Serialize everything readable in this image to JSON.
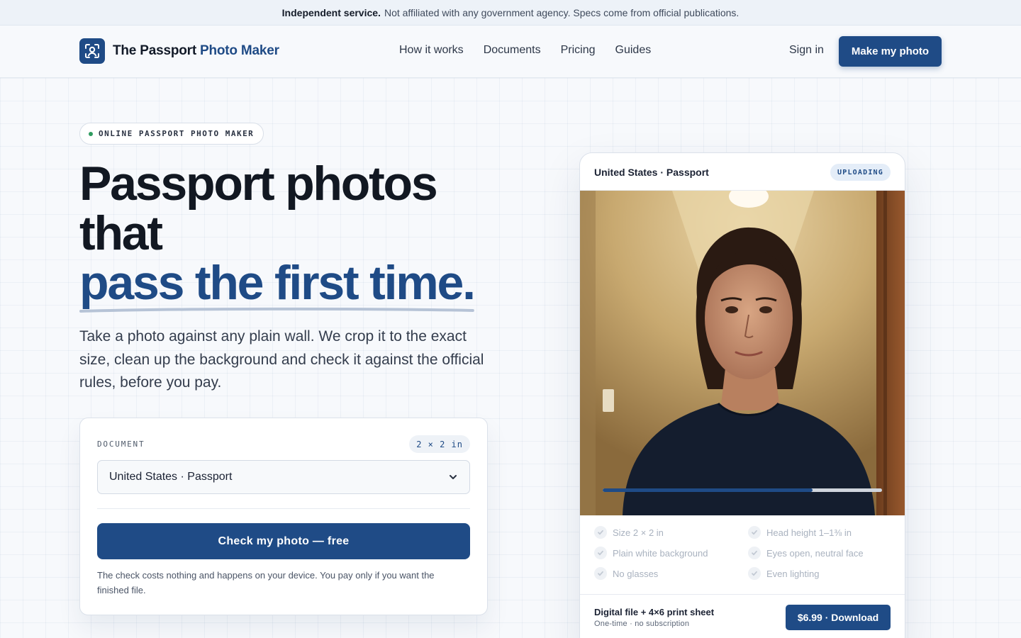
{
  "banner": {
    "strong": "Independent service.",
    "text": "Not affiliated with any government agency. Specs come from official publications."
  },
  "brand": {
    "name_part1": "The Passport",
    "name_part2": "Photo Maker",
    "accent_color": "#1f4b86"
  },
  "nav": {
    "links": [
      "How it works",
      "Documents",
      "Pricing",
      "Guides"
    ],
    "sign_in": "Sign in",
    "cta": "Make my photo"
  },
  "hero": {
    "eyebrow": "ONLINE PASSPORT PHOTO MAKER",
    "headline_line1": "Passport photos",
    "headline_line2": "that",
    "headline_highlight": "pass the first time.",
    "lede": "Take a photo against any plain wall. We crop it to the exact size, clean up the background and check it against the official rules, before you pay."
  },
  "form": {
    "document_label": "DOCUMENT",
    "size_chip": "2 × 2 in",
    "selected_document": "United States · Passport",
    "submit": "Check my photo — free",
    "note": "The check costs nothing and happens on your device. You pay only if you want the finished file."
  },
  "preview": {
    "title": "United States · Passport",
    "status": "UPLOADING",
    "progress": 0.75,
    "checks": [
      "Size 2 × 2 in",
      "Head height 1–1⅜ in",
      "Plain white background",
      "Eyes open, neutral face",
      "No glasses",
      "Even lighting"
    ],
    "footer_title": "Digital file + 4×6 print sheet",
    "footer_sub": "One-time · no subscription",
    "download": "$6.99 · Download"
  }
}
